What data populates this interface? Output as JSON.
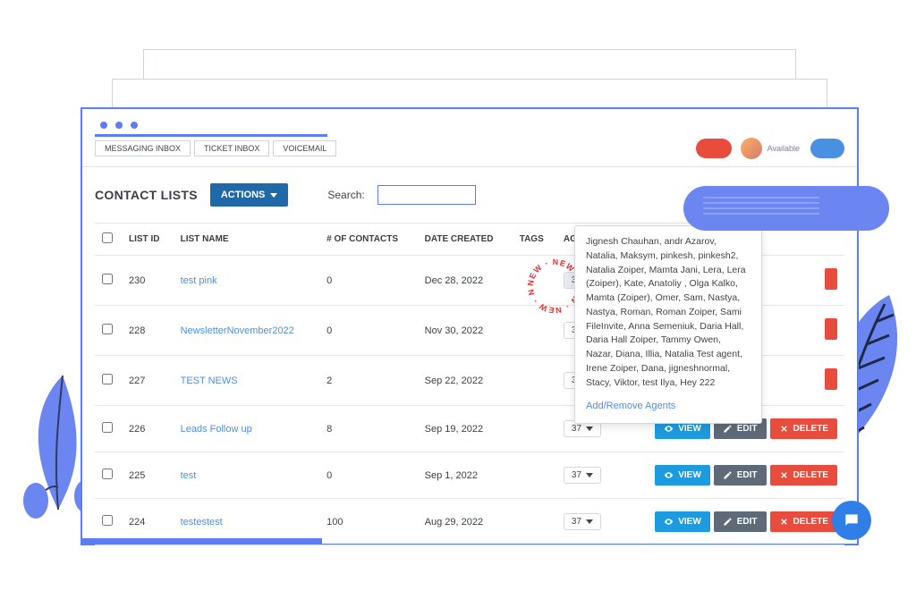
{
  "tabs": {
    "messaging": "MESSAGING INBOX",
    "ticket": "TICKET INBOX",
    "voicemail": "VOICEMAIL"
  },
  "status": {
    "available": "Available"
  },
  "header": {
    "title": "CONTACT LISTS",
    "actions": "ACTIONS",
    "search_label": "Search:",
    "search_value": ""
  },
  "columns": {
    "check": "",
    "id": "LIST ID",
    "name": "LIST NAME",
    "contacts": "# OF CONTACTS",
    "date": "DATE CREATED",
    "tags": "TAGS",
    "agents": "AGENTS"
  },
  "rows": [
    {
      "id": "230",
      "name": "test pink",
      "contacts": "0",
      "date": "Dec 28, 2022",
      "agents": "37",
      "popover": true
    },
    {
      "id": "228",
      "name": "NewsletterNovember2022",
      "contacts": "0",
      "date": "Nov 30, 2022",
      "agents": "37"
    },
    {
      "id": "227",
      "name": "TEST NEWS",
      "contacts": "2",
      "date": "Sep 22, 2022",
      "agents": "37"
    },
    {
      "id": "226",
      "name": "Leads Follow up",
      "contacts": "8",
      "date": "Sep 19, 2022",
      "agents": "37",
      "actions": true
    },
    {
      "id": "225",
      "name": "test",
      "contacts": "0",
      "date": "Sep 1, 2022",
      "agents": "37",
      "actions": true
    },
    {
      "id": "224",
      "name": "testestest",
      "contacts": "100",
      "date": "Aug 29, 2022",
      "agents": "37",
      "actions": true
    }
  ],
  "actions": {
    "view": "VIEW",
    "edit": "EDIT",
    "delete": "DELETE"
  },
  "popover": {
    "names": "Jignesh Chauhan, andr Azarov, Natalia, Maksym, pinkesh, pinkesh2, Natalia Zoiper, Mamta Jani, Lera, Lera (Zoiper), Kate, Anatoliy , Olga Kalko, Mamta (Zoiper), Omer, Sam, Nastya, Nastya, Roman, Roman Zoiper, Sami FileInvite, Anna Semeniuk, Daria Hall, Daria Hall Zoiper, Tammy Owen, Nazar, Diana, Illia, Natalia Test agent, Irene Zoiper, Dana, jigneshnormal, Stacy, Viktor, test Ilya, Hey 222",
    "link": "Add/Remove Agents"
  },
  "badge": "NEW"
}
